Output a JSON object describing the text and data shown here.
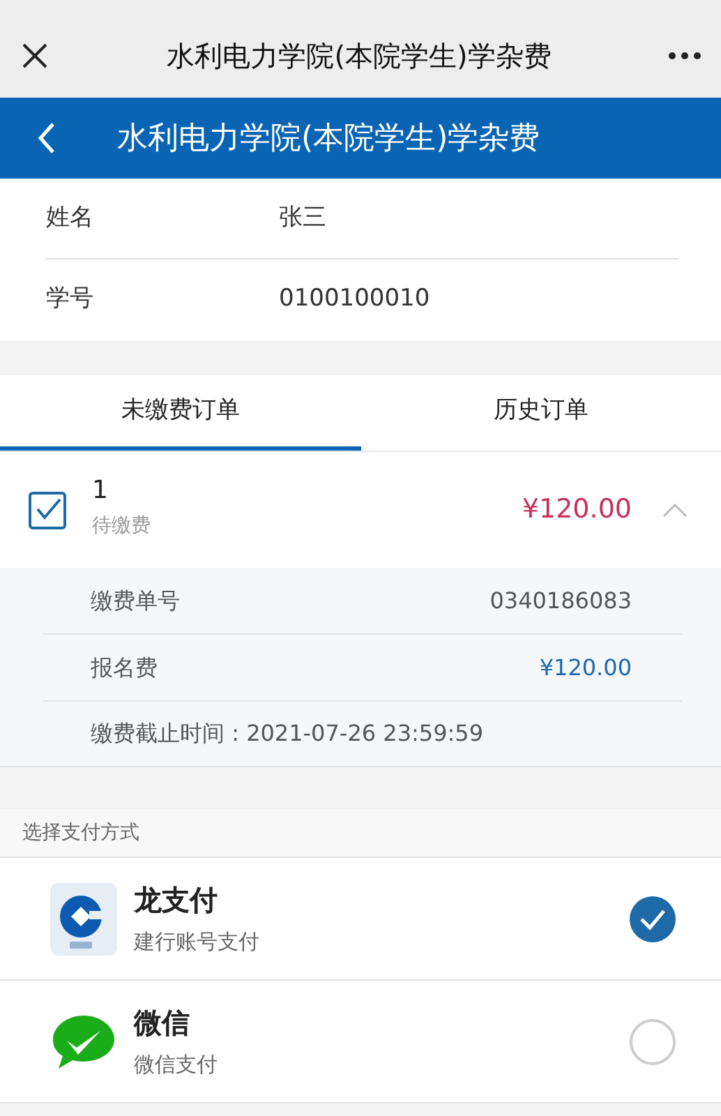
{
  "window": {
    "title": "水利电力学院(本院学生)学杂费"
  },
  "header": {
    "title": "水利电力学院(本院学生)学杂费"
  },
  "student_info": [
    {
      "label": "姓名",
      "value": "张三"
    },
    {
      "label": "学号",
      "value": "0100100010"
    }
  ],
  "tabs": [
    {
      "label": "未缴费订单",
      "selected": true
    },
    {
      "label": "历史订单",
      "selected": false
    }
  ],
  "orders": [
    {
      "number": "1",
      "status": "待缴费",
      "amount": "¥120.00",
      "checked": true,
      "expanded": true,
      "details": [
        {
          "label": "缴费单号",
          "value": "0340186083",
          "kind": "plain"
        },
        {
          "label": "报名费",
          "value": "¥120.00",
          "kind": "money"
        }
      ],
      "deadline": "缴费截止时间 : 2021-07-26 23:59:59"
    }
  ],
  "payment": {
    "heading": "选择支付方式",
    "methods": [
      {
        "kind": "bank",
        "name": "龙支付",
        "description": "建行账号支付",
        "selected": true
      },
      {
        "kind": "wechat",
        "name": "微信",
        "description": "微信支付",
        "selected": false
      }
    ]
  }
}
